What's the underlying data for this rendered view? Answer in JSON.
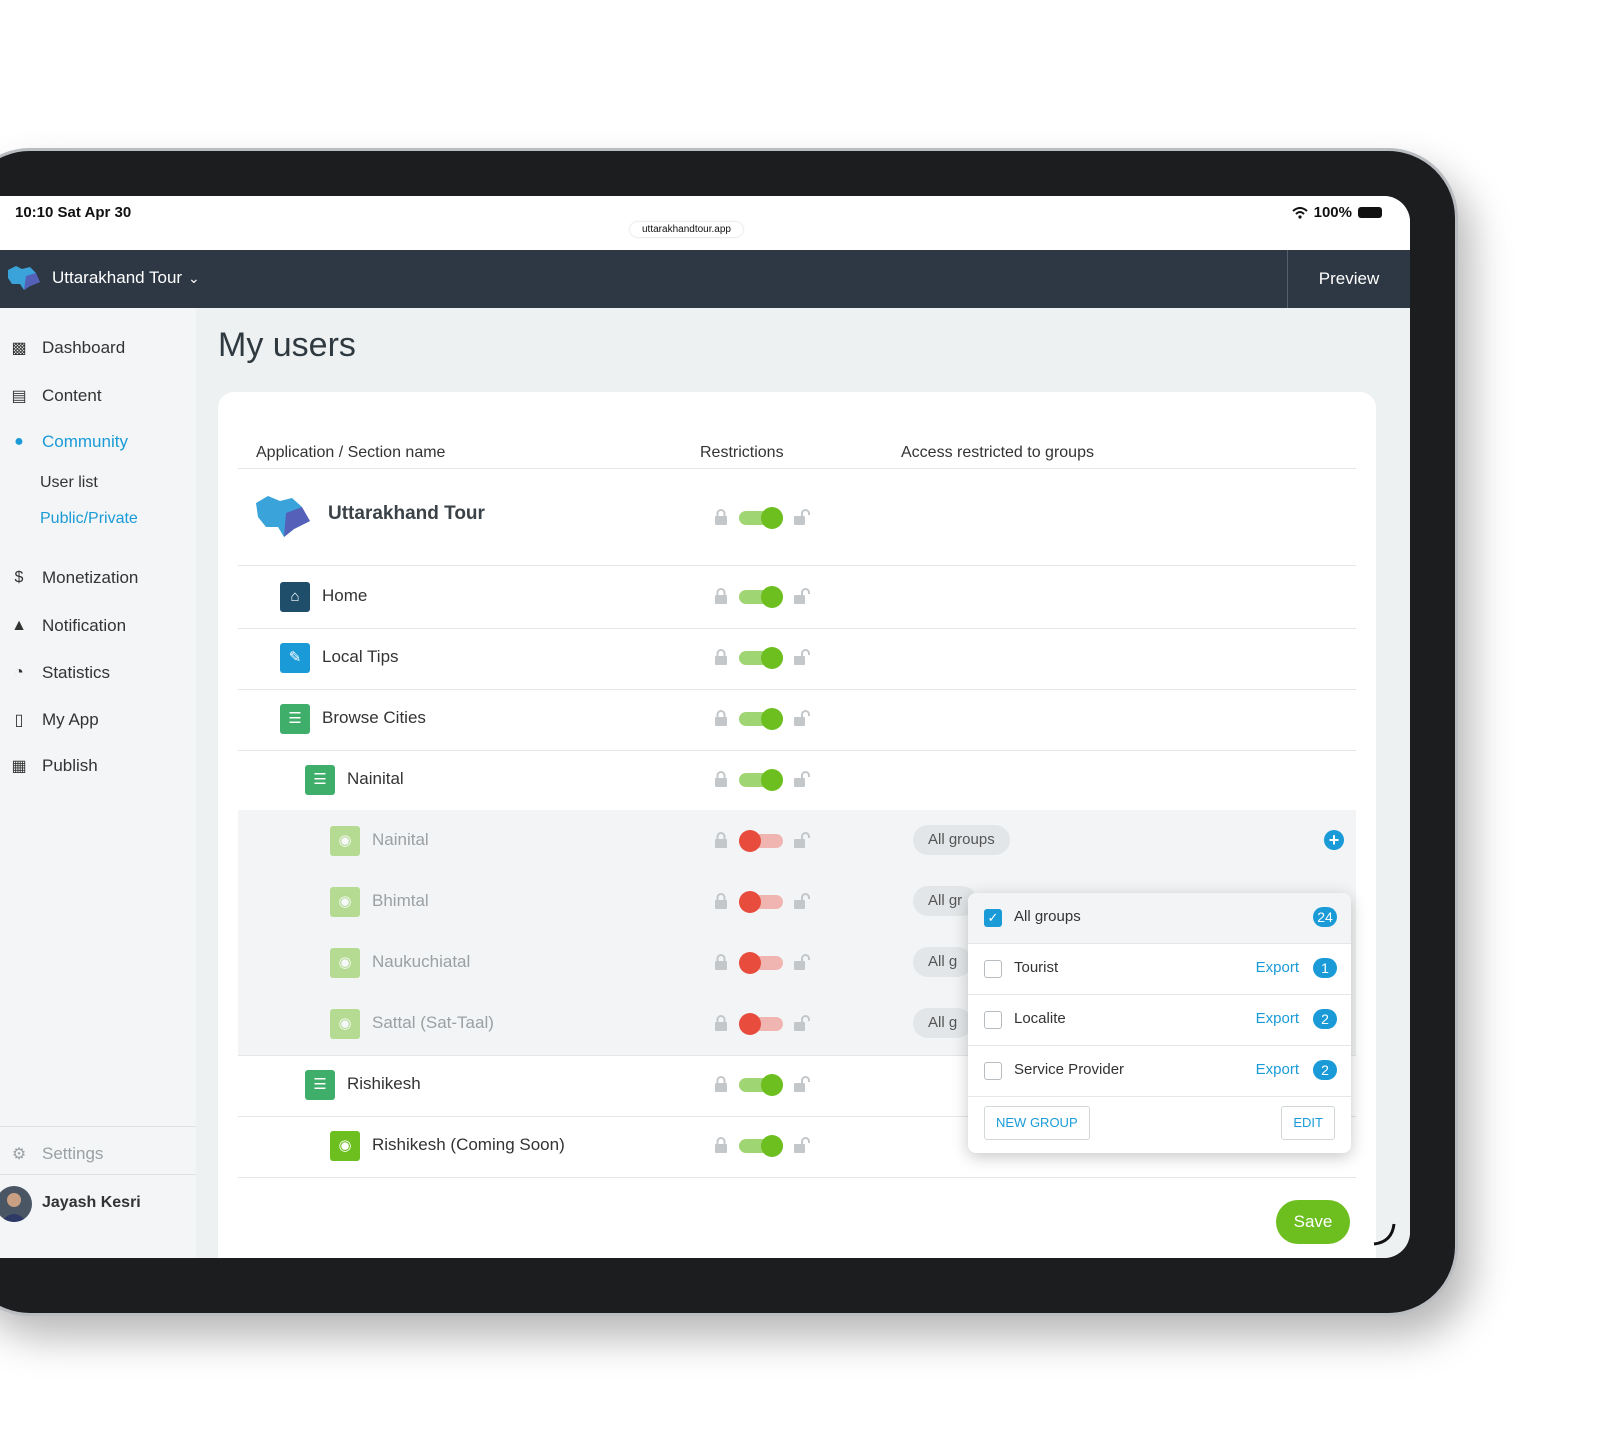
{
  "status_bar": {
    "time": "10:10  Sat Apr 30",
    "url": "uttarakhandtour.app",
    "battery": "100%"
  },
  "topbar": {
    "app_title": "Uttarakhand Tour",
    "preview": "Preview"
  },
  "sidebar": {
    "items": [
      {
        "label": "Dashboard",
        "icon": "bar-chart-icon"
      },
      {
        "label": "Content",
        "icon": "document-icon"
      },
      {
        "label": "Community",
        "icon": "person-icon"
      },
      {
        "label": "Monetization",
        "icon": "dollar-icon"
      },
      {
        "label": "Notification",
        "icon": "bell-icon"
      },
      {
        "label": "Statistics",
        "icon": "pie-chart-icon"
      },
      {
        "label": "My App",
        "icon": "phone-icon"
      },
      {
        "label": "Publish",
        "icon": "store-icon"
      }
    ],
    "subitems": [
      {
        "label": "User list"
      },
      {
        "label": "Public/Private"
      }
    ],
    "settings": "Settings",
    "user": "Jayash Kesri"
  },
  "page": {
    "title": "My users"
  },
  "table": {
    "headers": [
      "Application / Section name",
      "Restrictions",
      "Access restricted to groups"
    ],
    "app_row": {
      "label": "Uttarakhand Tour",
      "restricted": false
    },
    "rows": [
      {
        "label": "Home",
        "icon": "home-icon",
        "restricted": false
      },
      {
        "label": "Local Tips",
        "icon": "pencil-icon",
        "restricted": false
      },
      {
        "label": "Browse Cities",
        "icon": "list-icon",
        "restricted": false
      },
      {
        "label": "Nainital",
        "icon": "list-icon",
        "restricted": false
      },
      {
        "label": "Nainital",
        "icon": "map-pin-icon",
        "restricted": true,
        "groups": "All groups"
      },
      {
        "label": "Bhimtal",
        "icon": "map-pin-icon",
        "restricted": true,
        "groups": "All gr"
      },
      {
        "label": "Naukuchiatal",
        "icon": "map-pin-icon",
        "restricted": true,
        "groups": "All g"
      },
      {
        "label": "Sattal (Sat-Taal)",
        "icon": "map-pin-icon",
        "restricted": true,
        "groups": "All g"
      },
      {
        "label": "Rishikesh",
        "icon": "list-icon",
        "restricted": false
      },
      {
        "label": "Rishikesh (Coming Soon)",
        "icon": "map-pin-icon",
        "restricted": false
      }
    ]
  },
  "dropdown": {
    "groups": [
      {
        "label": "All groups",
        "checked": true,
        "count": "24"
      },
      {
        "label": "Tourist",
        "checked": false,
        "export": "Export",
        "count": "1"
      },
      {
        "label": "Localite",
        "checked": false,
        "export": "Export",
        "count": "2"
      },
      {
        "label": "Service Provider",
        "checked": false,
        "export": "Export",
        "count": "2"
      }
    ],
    "new_group": "NEW GROUP",
    "edit": "EDIT"
  },
  "save_label": "Save",
  "colors": {
    "accent": "#1a9bd7",
    "on": "#6cbf1e",
    "off": "#e74c3c",
    "topbar": "#2e3844"
  }
}
